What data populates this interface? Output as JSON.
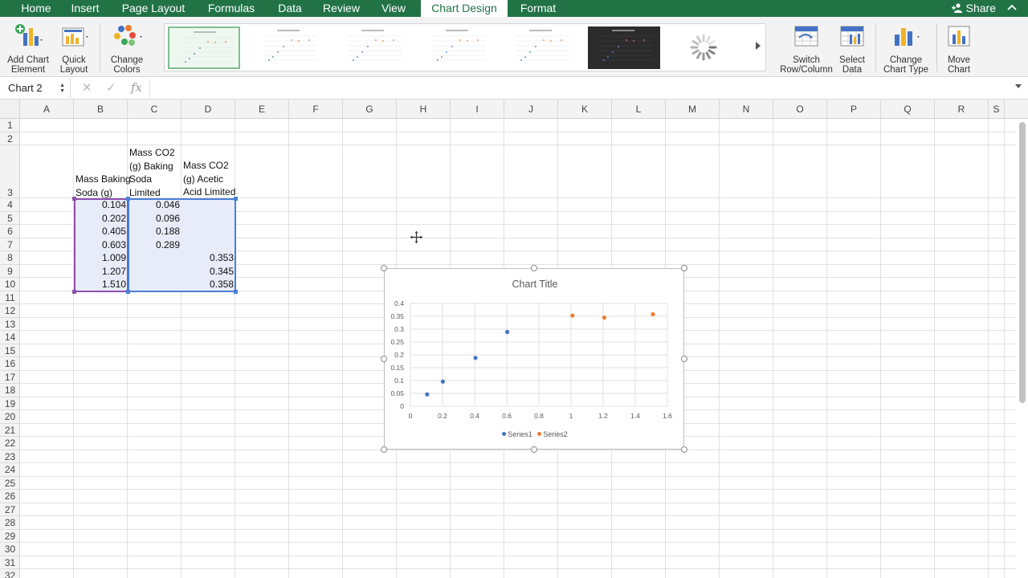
{
  "menu": {
    "tabs": [
      {
        "label": "Home"
      },
      {
        "label": "Insert"
      },
      {
        "label": "Page Layout"
      },
      {
        "label": "Formulas"
      },
      {
        "label": "Data"
      },
      {
        "label": "Review"
      },
      {
        "label": "View"
      },
      {
        "label": "Chart Design"
      },
      {
        "label": "Format"
      }
    ],
    "active_tab": "Chart Design",
    "share_label": "Share",
    "collapse_icon": "chevron-up-icon"
  },
  "ribbon": {
    "buttons": [
      {
        "line1": "Add Chart",
        "line2": "Element",
        "icon": "add-chart-element-icon"
      },
      {
        "line1": "Quick",
        "line2": "Layout",
        "icon": "quick-layout-icon"
      },
      {
        "line1": "Change",
        "line2": "Colors",
        "icon": "change-colors-icon"
      },
      {
        "line1": "Switch",
        "line2": "Row/Column",
        "icon": "switch-row-column-icon"
      },
      {
        "line1": "Select",
        "line2": "Data",
        "icon": "select-data-icon"
      },
      {
        "line1": "Change",
        "line2": "Chart Type",
        "icon": "change-chart-type-icon"
      },
      {
        "line1": "Move",
        "line2": "Chart",
        "icon": "move-chart-icon"
      }
    ],
    "styles_gallery": {
      "thumbnails": [
        {
          "style": "style-1",
          "selected": true,
          "theme": "light"
        },
        {
          "style": "style-2",
          "selected": false,
          "theme": "light"
        },
        {
          "style": "style-3",
          "selected": false,
          "theme": "light"
        },
        {
          "style": "style-4",
          "selected": false,
          "theme": "light"
        },
        {
          "style": "style-5",
          "selected": false,
          "theme": "light"
        },
        {
          "style": "style-6",
          "selected": false,
          "theme": "dark"
        }
      ],
      "loading": true
    }
  },
  "formula_bar": {
    "name_box": "Chart 2",
    "cancel_symbol": "✕",
    "confirm_symbol": "✓",
    "fx_symbol": "fx",
    "formula": ""
  },
  "columns": [
    "A",
    "B",
    "C",
    "D",
    "E",
    "F",
    "G",
    "H",
    "I",
    "J",
    "K",
    "L",
    "M",
    "N",
    "O",
    "P",
    "Q",
    "R",
    "S"
  ],
  "rows": [
    "1",
    "2",
    "3",
    "4",
    "5",
    "6",
    "7",
    "8",
    "9",
    "10",
    "11",
    "12",
    "13",
    "14",
    "15",
    "16",
    "17",
    "18",
    "19",
    "20",
    "21",
    "22",
    "23",
    "24",
    "25",
    "26",
    "27",
    "28",
    "29",
    "30",
    "31",
    "32"
  ],
  "sheet": {
    "header_B": "Mass Baking\nSoda (g)",
    "header_C": "Mass CO2\n(g) Baking\nSoda\nLimited",
    "header_D": "Mass CO2\n(g) Acetic\nAcid Limited",
    "table": [
      {
        "B": "0.104",
        "C": "0.046",
        "D": ""
      },
      {
        "B": "0.202",
        "C": "0.096",
        "D": ""
      },
      {
        "B": "0.405",
        "C": "0.188",
        "D": ""
      },
      {
        "B": "0.603",
        "C": "0.289",
        "D": ""
      },
      {
        "B": "1.009",
        "C": "",
        "D": "0.353"
      },
      {
        "B": "1.207",
        "C": "",
        "D": "0.345"
      },
      {
        "B": "1.510",
        "C": "",
        "D": "0.358"
      }
    ],
    "range_colors": {
      "x_range": "#8e4fae",
      "y_range": "#4a7fd6",
      "fill": "#e8ecf8"
    }
  },
  "chart_data": {
    "type": "scatter",
    "title": "Chart Title",
    "xlabel": "",
    "ylabel": "",
    "xlim": [
      0,
      1.6
    ],
    "ylim": [
      0,
      0.4
    ],
    "x_ticks": [
      "0",
      "0.2",
      "0.4",
      "0.6",
      "0.8",
      "1",
      "1.2",
      "1.4",
      "1.6"
    ],
    "y_ticks": [
      "0",
      "0.05",
      "0.1",
      "0.15",
      "0.2",
      "0.25",
      "0.3",
      "0.35",
      "0.4"
    ],
    "grid": true,
    "legend": "bottom",
    "series": [
      {
        "name": "Series1",
        "color": "#4472c4",
        "points": [
          [
            0.104,
            0.046
          ],
          [
            0.202,
            0.096
          ],
          [
            0.405,
            0.188
          ],
          [
            0.603,
            0.289
          ]
        ]
      },
      {
        "name": "Series2",
        "color": "#ed7d31",
        "points": [
          [
            1.009,
            0.353
          ],
          [
            1.207,
            0.345
          ],
          [
            1.51,
            0.358
          ]
        ]
      }
    ]
  },
  "colors": {
    "brand_green": "#217346",
    "ribbon_bg": "#f3f3f3",
    "header_bg": "#f3f3f3"
  }
}
